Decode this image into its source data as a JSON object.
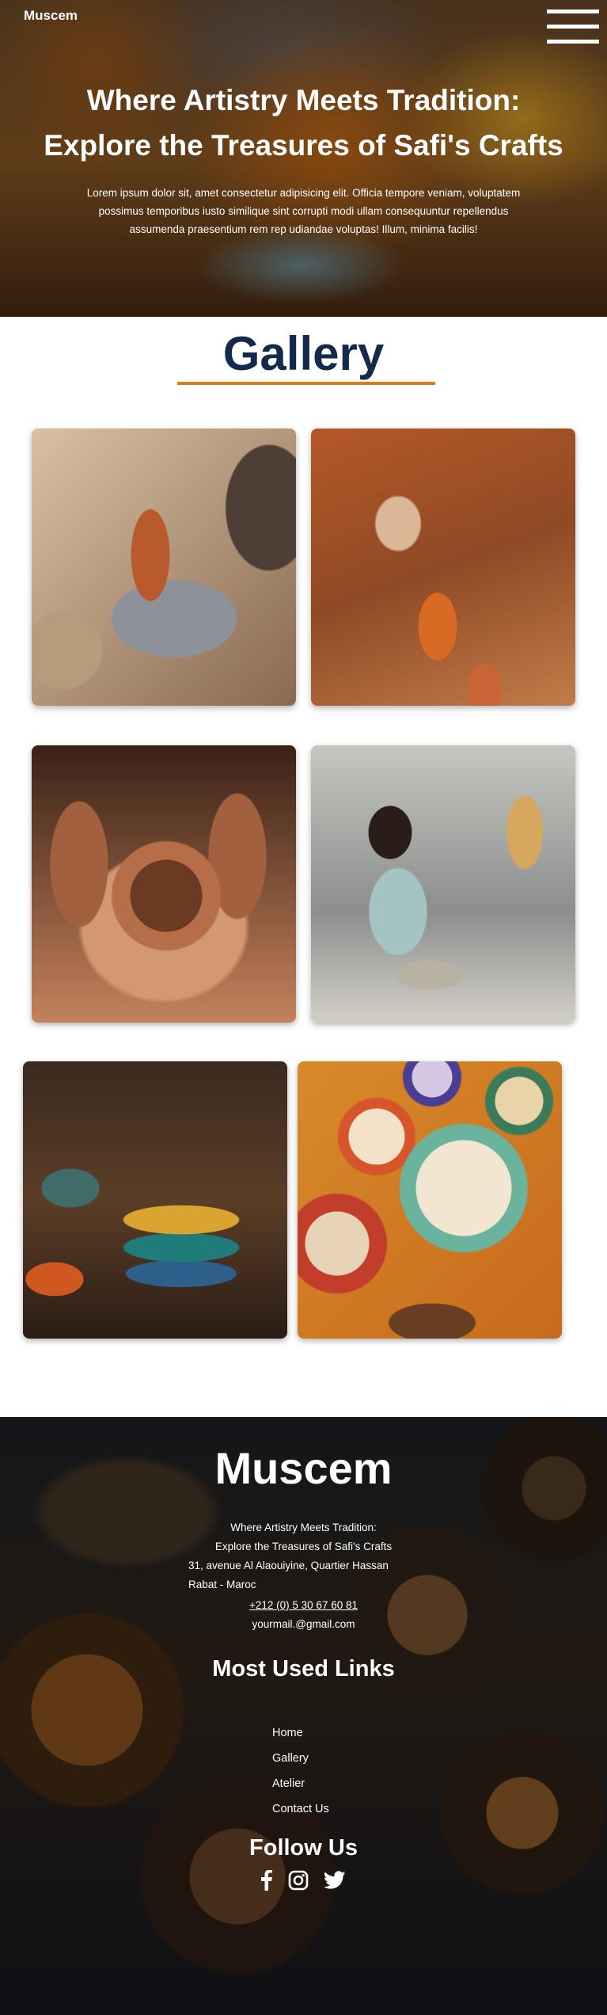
{
  "header": {
    "brand": "Muscem",
    "menu_icon": "hamburger-menu-icon"
  },
  "hero": {
    "title_line1": "Where Artistry Meets Tradition:",
    "title_line2": "Explore the Treasures of Safi's Crafts",
    "text_line1": "Lorem ipsum dolor sit, amet consectetur adipisicing elit. Officia tempore veniam, voluptatem",
    "text_line2": "possimus temporibus iusto similique sint corrupti modi ullam consequuntur repellendus",
    "text_line3": "assumenda praesentium rem rep udiandae voluptas! Illum, minima facilis!"
  },
  "gallery": {
    "title": "Gallery",
    "accent_color": "#d97a1b",
    "title_color": "#132a4d",
    "images": [
      "potter-hands-wheel-photo",
      "artisan-shaping-vase-photo",
      "clay-pot-hands-photo",
      "girl-pottery-wheel-photo",
      "painted-bowls-photo",
      "decorated-plates-photo"
    ]
  },
  "footer": {
    "brand": "Muscem",
    "tagline_line1": "Where Artistry Meets Tradition:",
    "tagline_line2": "Explore the Treasures of Safi's Crafts",
    "address_line1": "31, avenue Al Alaouiyine, Quartier Hassan",
    "address_line2": "Rabat - Maroc",
    "phone": "+212 (0) 5 30 67 60 81",
    "email": "yourmail.@gmail.com",
    "links_title": "Most Used Links",
    "links": [
      "Home",
      "Gallery",
      "Atelier",
      "Contact Us"
    ],
    "follow_title": "Follow Us",
    "social": [
      "facebook-icon",
      "instagram-icon",
      "twitter-icon"
    ]
  }
}
